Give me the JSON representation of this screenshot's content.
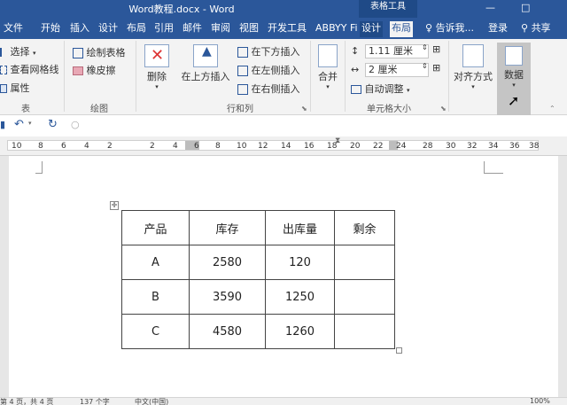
{
  "window": {
    "title": "Word教程.docx - Word",
    "context_tab_group": "表格工具",
    "minimize": "—",
    "restore": "□"
  },
  "tabs": [
    "文件",
    "开始",
    "插入",
    "设计",
    "布局",
    "引用",
    "邮件",
    "审阅",
    "视图",
    "开发工具",
    "ABBYY Fi",
    "设计",
    "布局"
  ],
  "tell_me": "告诉我...",
  "sign_in": "登录",
  "share": "共享",
  "ribbon": {
    "table_group": {
      "select": "选择",
      "view_gridlines": "查看网格线",
      "properties": "属性",
      "label": "表"
    },
    "draw_group": {
      "draw_table": "绘制表格",
      "eraser": "橡皮擦",
      "label": "绘图"
    },
    "rows_cols_group": {
      "delete": "删除",
      "insert_above": "在上方插入",
      "insert_below": "在下方插入",
      "insert_left": "在左侧插入",
      "insert_right": "在右侧插入",
      "label": "行和列"
    },
    "merge": "合并",
    "cell_size_group": {
      "height": "1.11 厘米",
      "width": "2 厘米",
      "autofit": "自动调整",
      "label": "单元格大小"
    },
    "align": "对齐方式",
    "data": "数据"
  },
  "ruler": {
    "numbers": [
      "10",
      "8",
      "6",
      "4",
      "2",
      "2",
      "4",
      "6",
      "8",
      "10",
      "12",
      "14",
      "16",
      "18",
      "20",
      "22",
      "24",
      "28",
      "30",
      "32",
      "34",
      "36",
      "38"
    ]
  },
  "table": {
    "headers": [
      "产品",
      "库存",
      "出库量",
      "剩余"
    ],
    "rows": [
      [
        "A",
        "2580",
        "120",
        ""
      ],
      [
        "B",
        "3590",
        "1250",
        ""
      ],
      [
        "C",
        "4580",
        "1260",
        ""
      ]
    ]
  },
  "status": {
    "page": "第 4 页，共 4 页",
    "words": "137 个字",
    "language": "中文(中国)",
    "zoom": "100%"
  },
  "colors": {
    "brand": "#2b579a",
    "ribbon_bg": "#f3f3f3",
    "data_button_active": "#c5c5c5"
  }
}
